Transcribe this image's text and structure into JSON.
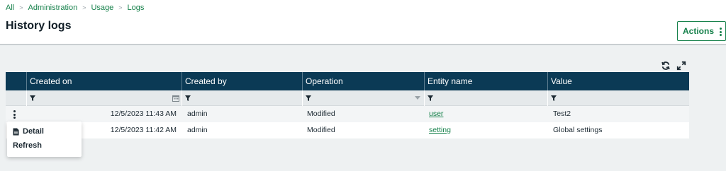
{
  "breadcrumb": {
    "items": [
      "All",
      "Administration",
      "Usage",
      "Logs"
    ],
    "separator": ">"
  },
  "page": {
    "title": "History logs"
  },
  "header": {
    "actions_label": "Actions"
  },
  "toolbar": {
    "refresh_icon": "refresh-icon",
    "expand_icon": "expand-icon"
  },
  "table": {
    "columns": [
      "Created on",
      "Created by",
      "Operation",
      "Entity name",
      "Value"
    ],
    "rows": [
      {
        "created_on": "12/5/2023 11:43 AM",
        "created_by": "admin",
        "operation": "Modified",
        "entity_name": "user",
        "value": "Test2"
      },
      {
        "created_on": "12/5/2023 11:42 AM",
        "created_by": "admin",
        "operation": "Modified",
        "entity_name": "setting",
        "value": "Global settings"
      }
    ]
  },
  "row_menu": {
    "items": [
      "Detail",
      "Refresh"
    ]
  },
  "colors": {
    "accent": "#15804a",
    "header_bg": "#0b3a55",
    "filter_bg": "#e5e9eb"
  }
}
